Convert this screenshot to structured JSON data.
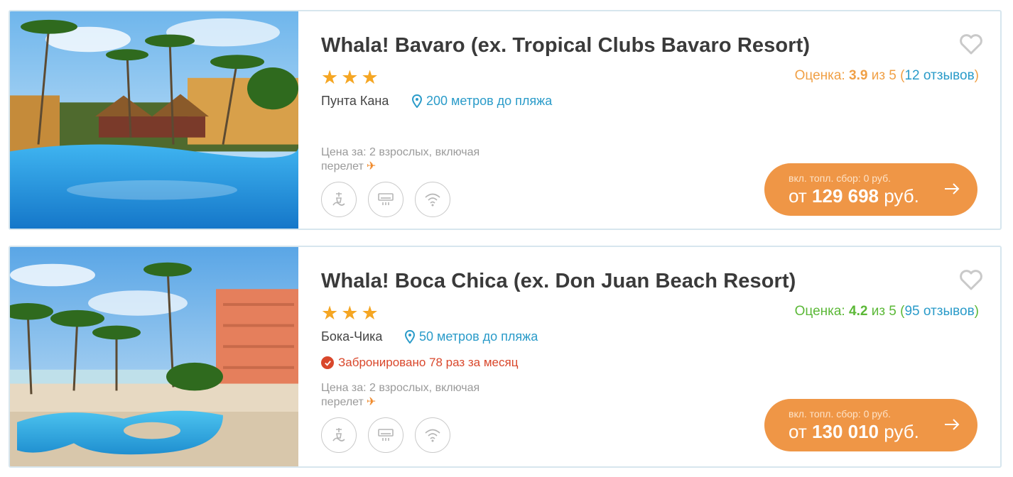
{
  "colors": {
    "accent": "#ef9646",
    "link": "#2a9bc9",
    "star": "#f5a623",
    "rating_mid": "#f0a046",
    "rating_good": "#5bb837",
    "booked": "#d9472b"
  },
  "hotels": [
    {
      "name": "Whala! Bavaro (ex. Tropical Clubs Bavaro Resort)",
      "stars": 3,
      "rating_label": "Оценка:",
      "rating_value": "3.9",
      "rating_of": "из 5",
      "reviews": "12 отзывов",
      "city": "Пунта Кана",
      "beach": "200 метров до пляжа",
      "booked": "",
      "price_note_line1": "Цена за: 2 взрослых, включая",
      "price_note_line2": "перелет",
      "fee": "вкл. топл. сбор: 0 руб.",
      "price_prefix": "от",
      "price": "129 698",
      "currency": "руб.",
      "amenities": [
        "beach-shower-icon",
        "air-conditioner-icon",
        "wifi-icon"
      ]
    },
    {
      "name": "Whala! Boca Chica (ex. Don Juan Beach Resort)",
      "stars": 3,
      "rating_label": "Оценка:",
      "rating_value": "4.2",
      "rating_of": "из 5",
      "reviews": "95 отзывов",
      "city": "Бока-Чика",
      "beach": "50 метров до пляжа",
      "booked": "Забронировано 78 раз за месяц",
      "price_note_line1": "Цена за: 2 взрослых, включая",
      "price_note_line2": "перелет",
      "fee": "вкл. топл. сбор: 0 руб.",
      "price_prefix": "от",
      "price": "130 010",
      "currency": "руб.",
      "amenities": [
        "beach-shower-icon",
        "air-conditioner-icon",
        "wifi-icon"
      ]
    }
  ]
}
